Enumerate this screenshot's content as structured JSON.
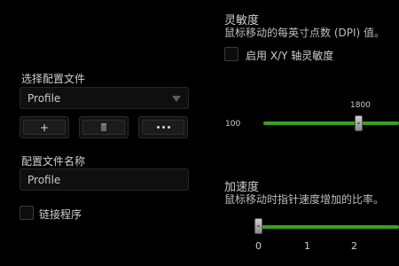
{
  "sensitivity": {
    "title": "灵敏度",
    "description": "鼠标移动的每英寸点数 (DPI) 值。",
    "xy_checkbox_label": "启用 X/Y 轴灵敏度",
    "xy_checked": false,
    "min_label": "100",
    "value_label": "1800",
    "value": 1800
  },
  "profile": {
    "section_label": "选择配置文件",
    "selected": "Profile",
    "add_label": "+",
    "name_label": "配置文件名称",
    "name_value": "Profile",
    "link_program_label": "链接程序",
    "link_program_checked": false
  },
  "acceleration": {
    "title": "加速度",
    "description": "鼠标移动时指针速度增加的比率。",
    "ticks": [
      "0",
      "1",
      "2"
    ],
    "value": 0
  },
  "colors": {
    "accent": "#39a21c",
    "background": "#000000"
  }
}
